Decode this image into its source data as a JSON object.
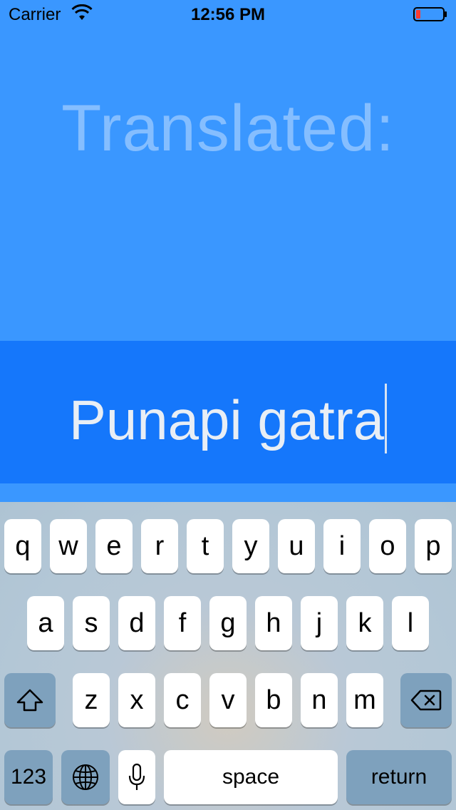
{
  "status_bar": {
    "carrier": "Carrier",
    "time": "12:56 PM",
    "battery_color": "#ff3b30"
  },
  "title": "Translated:",
  "input": {
    "value": "Punapi gatra"
  },
  "keyboard": {
    "row1": [
      "q",
      "w",
      "e",
      "r",
      "t",
      "y",
      "u",
      "i",
      "o",
      "p"
    ],
    "row2": [
      "a",
      "s",
      "d",
      "f",
      "g",
      "h",
      "j",
      "k",
      "l"
    ],
    "row3": [
      "z",
      "x",
      "c",
      "v",
      "b",
      "n",
      "m"
    ],
    "numbers_label": "123",
    "space_label": "space",
    "return_label": "return"
  },
  "colors": {
    "background": "#3a97ff",
    "input_band": "#1577fb"
  }
}
